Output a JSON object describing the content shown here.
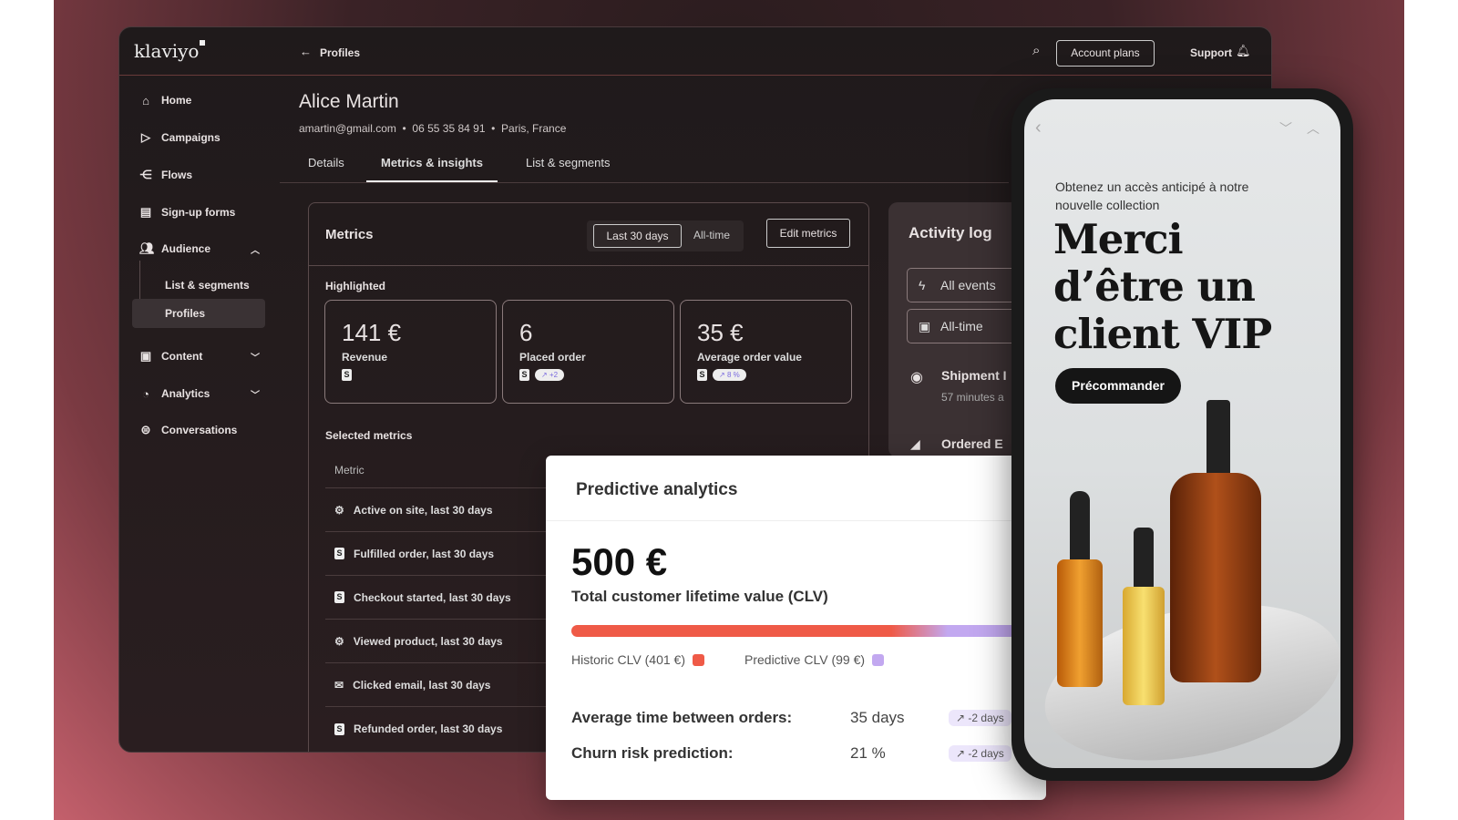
{
  "app": {
    "logo": "klaviyo",
    "breadcrumb": "Profiles",
    "account_plans": "Account plans",
    "support": "Support"
  },
  "sidebar": {
    "items": [
      {
        "label": "Home",
        "icon": "home-icon"
      },
      {
        "label": "Campaigns",
        "icon": "send-icon"
      },
      {
        "label": "Flows",
        "icon": "flows-icon"
      },
      {
        "label": "Sign-up forms",
        "icon": "form-icon"
      },
      {
        "label": "Audience",
        "icon": "people-icon",
        "expanded": true
      },
      {
        "label": "List & segments"
      },
      {
        "label": "Profiles",
        "active": true
      },
      {
        "label": "Content",
        "icon": "content-icon"
      },
      {
        "label": "Analytics",
        "icon": "analytics-icon"
      },
      {
        "label": "Conversations",
        "icon": "chat-icon"
      }
    ]
  },
  "profile": {
    "name": "Alice Martin",
    "email": "amartin@gmail.com",
    "phone": "06 55 35 84 91",
    "location": "Paris, France"
  },
  "tabs": [
    {
      "label": "Details"
    },
    {
      "label": "Metrics & insights",
      "active": true
    },
    {
      "label": "List & segments"
    }
  ],
  "metrics": {
    "title": "Metrics",
    "range_30": "Last 30 days",
    "range_all": "All-time",
    "edit": "Edit metrics",
    "selected_range": "Last 30 days",
    "highlighted_label": "Highlighted",
    "cards": [
      {
        "value": "141 €",
        "label": "Revenue",
        "badge": ""
      },
      {
        "value": "6",
        "label": "Placed order",
        "badge": "+2"
      },
      {
        "value": "35 €",
        "label": "Average order value",
        "badge": "8 %"
      }
    ],
    "selected_label": "Selected metrics",
    "column": "Metric",
    "rows": [
      {
        "label": "Active on site, last 30 days",
        "icon": "gear-icon"
      },
      {
        "label": "Fulfilled order, last 30 days",
        "icon": "shopify-icon"
      },
      {
        "label": "Checkout started, last 30 days",
        "icon": "shopify-icon"
      },
      {
        "label": "Viewed product, last 30 days",
        "icon": "gear-icon"
      },
      {
        "label": "Clicked email, last 30 days",
        "icon": "email-icon"
      },
      {
        "label": "Refunded order, last 30 days",
        "icon": "shopify-icon"
      }
    ]
  },
  "activity": {
    "title": "Activity log",
    "filter_events": "All events",
    "filter_time": "All-time",
    "items": [
      {
        "title": "Shipment I",
        "time": "57 minutes a"
      },
      {
        "title": "Ordered E"
      }
    ]
  },
  "predictive": {
    "title": "Predictive analytics",
    "total": "500 €",
    "subtitle": "Total customer lifetime value (CLV)",
    "historic_label": "Historic CLV (401 €)",
    "predictive_label": "Predictive CLV (99 €)",
    "historic_value": 401,
    "predictive_value": 99,
    "historic_color": "#ef5a47",
    "predictive_color": "#c2a8f0",
    "rows": [
      {
        "label": "Average time between orders:",
        "value": "35 days",
        "change": "-2 days"
      },
      {
        "label": "Churn risk prediction:",
        "value": "21 %",
        "change": "-2 days"
      }
    ]
  },
  "phone": {
    "eyebrow": "Obtenez un accès anticipé à notre nouvelle collection",
    "headline": "Merci d’être un client VIP",
    "cta": "Précommander"
  }
}
